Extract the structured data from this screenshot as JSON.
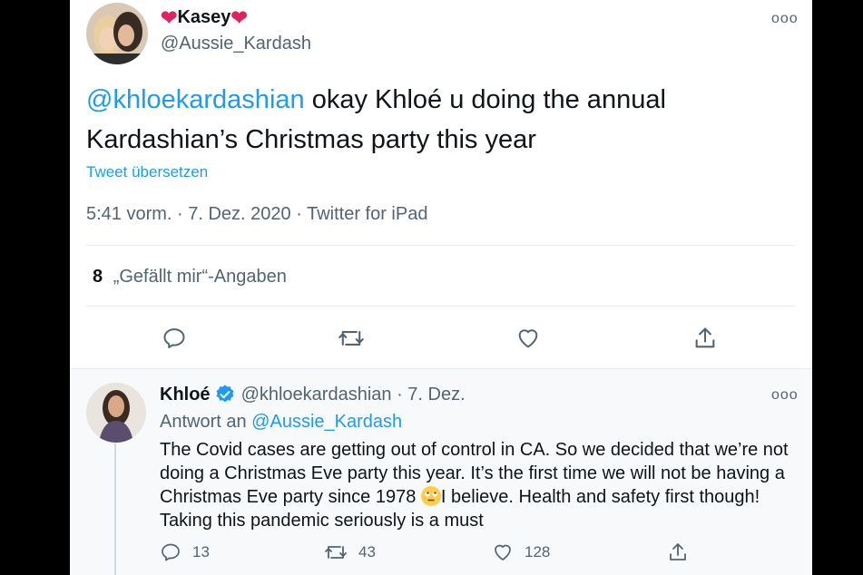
{
  "main_tweet": {
    "display_name": "Kasey",
    "handle": "@Aussie_Kardash",
    "mention": "@khloekardashian",
    "text": " okay Khloé u doing the annual Kardashian’s Christmas party this year",
    "translate_label": "Tweet übersetzen",
    "timestamp": "5:41 vorm. · 7. Dez. 2020 · Twitter for iPad",
    "likes_count": "8",
    "likes_label": "„Gefällt mir“-Angaben",
    "more_label": "ooo"
  },
  "reply_tweet": {
    "display_name": "Khloé",
    "handle_date": "@khloekardashian · 7. Dez.",
    "replying_prefix": "Antwort an ",
    "replying_to": "@Aussie_Kardash",
    "text_before_emoji": "The Covid cases are getting out of control in CA. So we decided that we’re not doing a Christmas Eve party this year. It’s the first time we will not be having a Christmas Eve party since 1978 ",
    "text_after_emoji": "I believe. Health and safety first though! Taking this pandemic seriously is a must",
    "reply_count": "13",
    "retweet_count": "43",
    "like_count": "128",
    "more_label": "ooo"
  },
  "colors": {
    "accent": "#1d9bf0",
    "heart": "#e0245e",
    "verified": "#1d9bf0",
    "secondary_text": "#536471"
  }
}
